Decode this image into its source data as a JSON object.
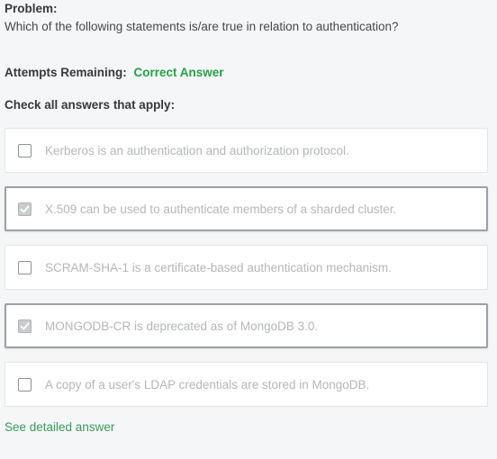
{
  "problem": {
    "heading": "Problem:",
    "question": "Which of the following statements is/are true in relation to authentication?"
  },
  "attempts": {
    "label": "Attempts Remaining:",
    "value": "Correct Answer"
  },
  "instructions": "Check all answers that apply:",
  "answers": [
    {
      "label": "Kerberos is an authentication and authorization protocol.",
      "checked": false
    },
    {
      "label": "X.509 can be used to authenticate members of a sharded cluster.",
      "checked": true
    },
    {
      "label": "SCRAM-SHA-1 is a certificate-based authentication mechanism.",
      "checked": false
    },
    {
      "label": "MONGODB-CR is deprecated as of MongoDB 3.0.",
      "checked": true
    },
    {
      "label": "A copy of a user's LDAP credentials are stored in MongoDB.",
      "checked": false
    }
  ],
  "see_answer_link": "See detailed answer",
  "colors": {
    "correct_green": "#26a04a",
    "link_green": "#3c9a5a",
    "page_background": "#f5f6f7"
  },
  "icons": {
    "checkbox_checked": "check-icon"
  }
}
